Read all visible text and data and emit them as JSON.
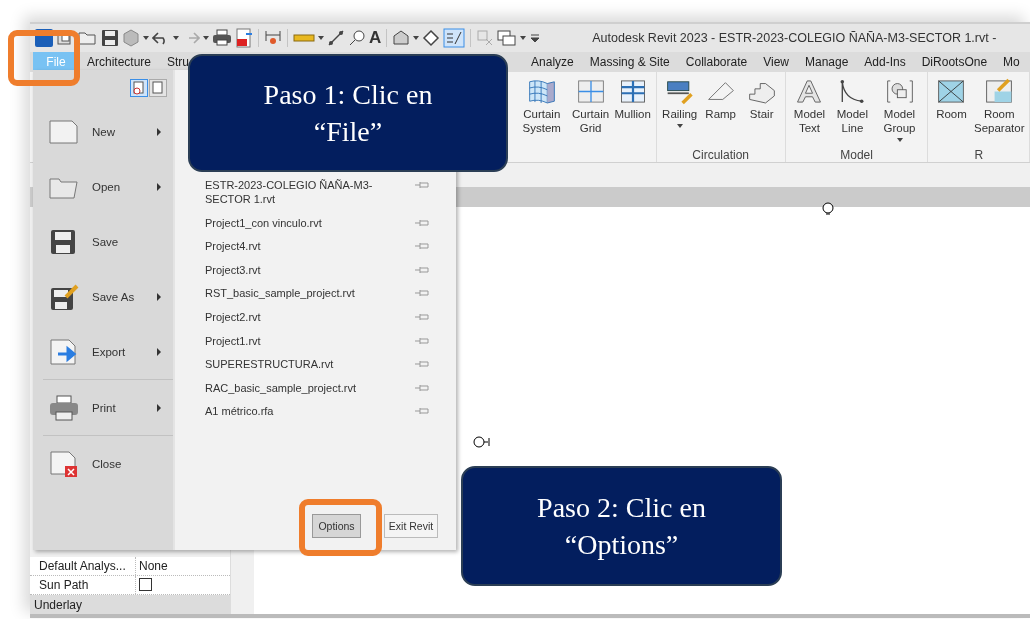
{
  "window": {
    "title": "Autodesk Revit 2023 - ESTR-2023-COLEGIO ÑAÑA-M3-SECTOR 1.rvt -"
  },
  "quick_access": {
    "text_glyph": "A"
  },
  "tabs": [
    {
      "label": "File",
      "selected": true
    },
    {
      "label": "Architecture",
      "selected": false
    },
    {
      "label": "Stru",
      "selected": false
    },
    {
      "label": "Analyze",
      "selected": false
    },
    {
      "label": "Massing & Site",
      "selected": false
    },
    {
      "label": "Collaborate",
      "selected": false
    },
    {
      "label": "View",
      "selected": false
    },
    {
      "label": "Manage",
      "selected": false
    },
    {
      "label": "Add-Ins",
      "selected": false
    },
    {
      "label": "DiRootsOne",
      "selected": false
    },
    {
      "label": "Mo",
      "selected": false
    }
  ],
  "ribbon": {
    "panels": [
      {
        "tools": [
          {
            "label": "Curtain System",
            "dropdown": false
          },
          {
            "label": "Curtain Grid",
            "dropdown": false
          },
          {
            "label": "Mullion",
            "dropdown": false
          }
        ]
      },
      {
        "label": "Circulation",
        "tools": [
          {
            "label": "Railing",
            "dropdown": true
          },
          {
            "label": "Ramp",
            "dropdown": false
          },
          {
            "label": "Stair",
            "dropdown": false
          }
        ]
      },
      {
        "label": "Model",
        "tools": [
          {
            "label": "Model Text",
            "dropdown": false
          },
          {
            "label": "Model Line",
            "dropdown": false
          },
          {
            "label": "Model Group",
            "dropdown": true
          }
        ]
      },
      {
        "label": "R",
        "tools": [
          {
            "label": "Room",
            "dropdown": false
          },
          {
            "label": "Room Separator",
            "dropdown": false
          }
        ]
      }
    ]
  },
  "file_menu": {
    "view_buttons": [
      {
        "selected": true
      },
      {
        "selected": false
      }
    ],
    "commands": [
      {
        "label": "New",
        "submenu": true
      },
      {
        "label": "Open",
        "submenu": true
      },
      {
        "label": "Save",
        "submenu": false
      },
      {
        "label": "Save As",
        "submenu": true
      },
      {
        "label": "Export",
        "submenu": true
      },
      {
        "label": "Print",
        "submenu": true
      },
      {
        "label": "Close",
        "submenu": false
      }
    ],
    "recent_files": [
      "ESTR-2023-COLEGIO ÑAÑA-M3-SECTOR 1.rvt",
      "Project1_con vinculo.rvt",
      "Project4.rvt",
      "Project3.rvt",
      "RST_basic_sample_project.rvt",
      "Project2.rvt",
      "Project1.rvt",
      "SUPERESTRUCTURA.rvt",
      "RAC_basic_sample_project.rvt",
      "A1 métrico.rfa"
    ],
    "buttons": [
      "Options",
      "Exit Revit"
    ]
  },
  "properties": {
    "rows": [
      {
        "kind": "text",
        "name": "Default Analys...",
        "value": "None"
      },
      {
        "kind": "checkbox",
        "name": "Sun Path",
        "checked": false
      }
    ],
    "section": "Underlay"
  },
  "callouts": [
    "Paso 1: Clic en “File”",
    "Paso 2: Clic en “Options”"
  ]
}
